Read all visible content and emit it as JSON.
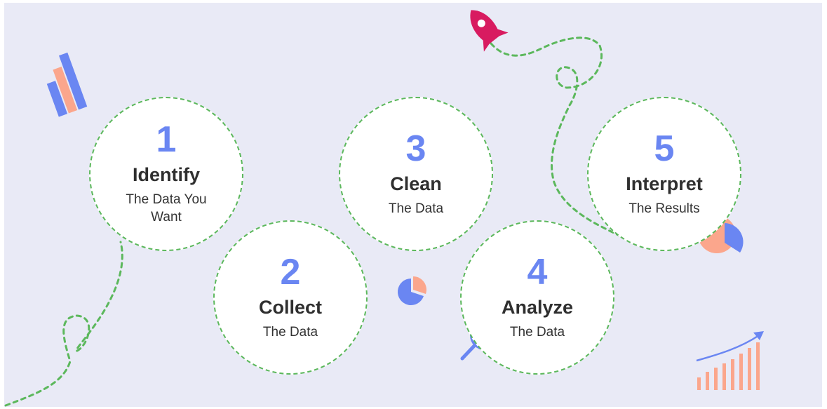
{
  "steps": [
    {
      "number": "1",
      "title": "Identify",
      "subtitle": "The Data You Want"
    },
    {
      "number": "2",
      "title": "Collect",
      "subtitle": "The Data"
    },
    {
      "number": "3",
      "title": "Clean",
      "subtitle": "The Data"
    },
    {
      "number": "4",
      "title": "Analyze",
      "subtitle": "The Data"
    },
    {
      "number": "5",
      "title": "Interpret",
      "subtitle": "The Results"
    }
  ],
  "colors": {
    "background": "#e9eaf6",
    "number": "#6a86f2",
    "dashed_path": "#5cb85c",
    "blue_accent": "#6a86f2",
    "salmon_accent": "#fba68c",
    "rocket": "#d81b60"
  },
  "icons": [
    "bar-chart-icon",
    "rocket-icon",
    "pie-chart-icon",
    "magnifier-icon",
    "growth-chart-icon"
  ]
}
